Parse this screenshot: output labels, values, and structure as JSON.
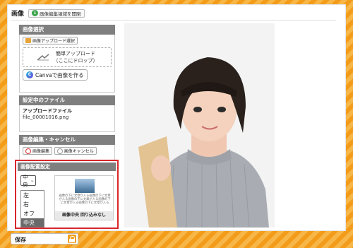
{
  "header": {
    "section_title": "画像",
    "toggle_label": "画像編集領域を開閉"
  },
  "image_select": {
    "title": "画像選択",
    "upload_button": "画像アップロード選択",
    "drop_line1": "簡単アップロード",
    "drop_line2": "（ここにドロップ）",
    "canva_button": "Canvaで画像を作る"
  },
  "current_file": {
    "title": "設定中のファイル",
    "label": "アップロードファイル",
    "filename": "file_00001016.png"
  },
  "edit_cancel": {
    "title": "画像編集・キャンセル",
    "edit_button": "画像編集",
    "cancel_button": "画像キャンセル"
  },
  "placement": {
    "title": "画像配置設定",
    "selected": "中央",
    "options": [
      "左",
      "右",
      "オフ",
      "中央"
    ],
    "preview_text": "画像の下に文章が入る画像の下に文章が入る画像の下に文章が入る画像の下に文章が入る画像の下に文章が入る",
    "preview_caption": "画像中央 回り込みなし"
  },
  "footer": {
    "save_label": "保存"
  },
  "colors": {
    "accent_orange": "#f39c1a",
    "highlight_red": "#d8262c",
    "panel_gray": "#7f7f7f"
  }
}
